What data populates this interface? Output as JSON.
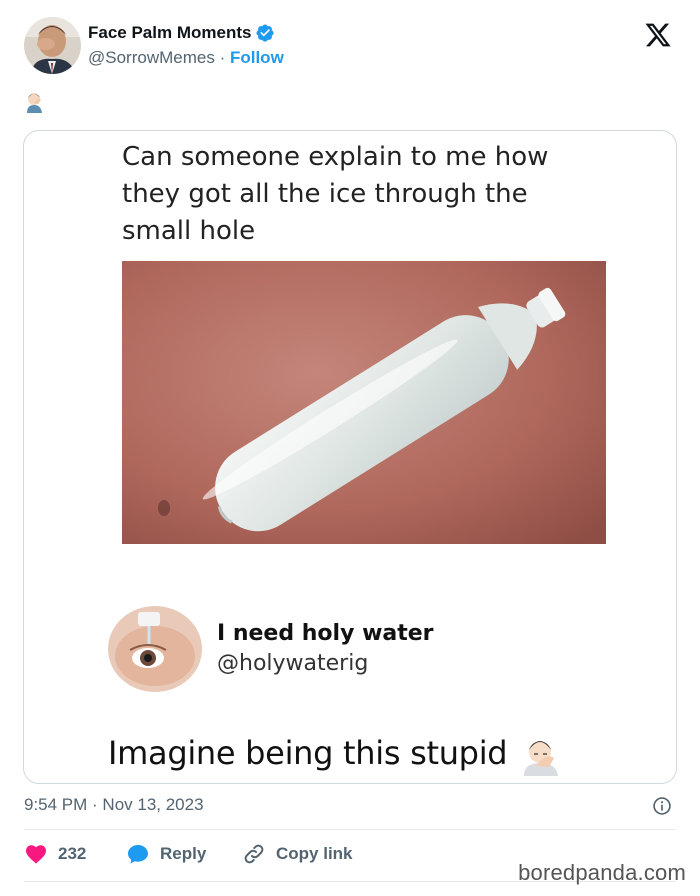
{
  "author": {
    "display_name": "Face Palm Moments",
    "handle": "@SorrowMemes",
    "follow_label": "Follow",
    "verified": true
  },
  "post_emoji_icon": "face-palm-emoji",
  "quoted_meme": {
    "caption": "Can someone explain to me how they got all the ice through the small hole",
    "photo": "frozen-bottle-photo",
    "reply": {
      "name": "I need holy water",
      "handle": "@holywaterig",
      "text": "Imagine being this stupid",
      "emoji_icon": "face-palm-emoji"
    }
  },
  "timestamp": "9:54 PM · Nov 13, 2023",
  "actions": {
    "likes": "232",
    "reply_label": "Reply",
    "copy_link_label": "Copy link"
  },
  "watermark": "boredpanda.com",
  "colors": {
    "accent": "#1d9bf0",
    "like": "#f91880",
    "muted": "#536471",
    "border": "#cfd9de"
  }
}
